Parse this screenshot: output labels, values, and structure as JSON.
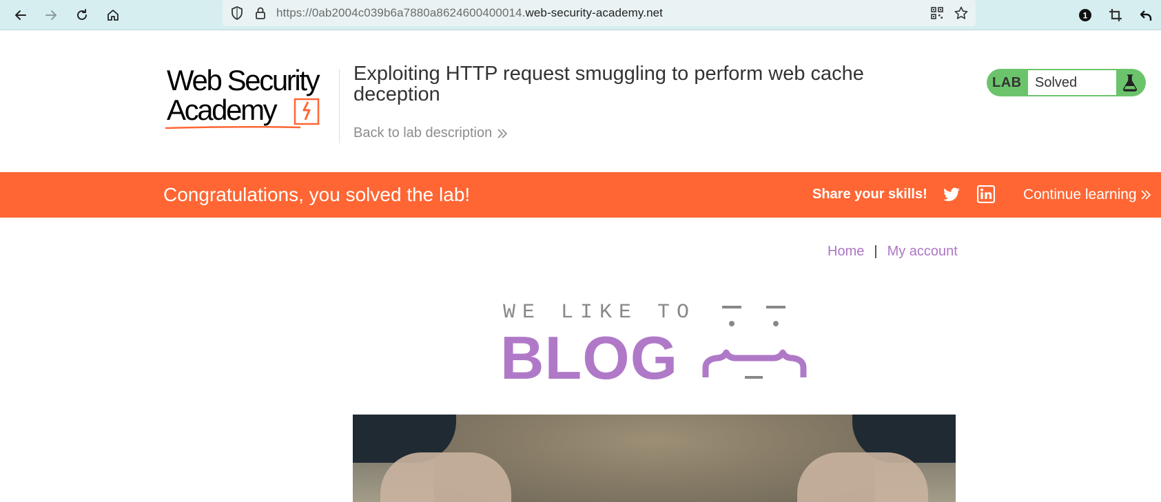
{
  "browser": {
    "url_prefix": "https://0ab2004c039b6a7880a8624600400014.",
    "url_domain": "web-security-academy.net",
    "notification_count": "1"
  },
  "lab": {
    "logo_line1": "Web Security",
    "logo_line2": "Academy",
    "title": "Exploiting HTTP request smuggling to perform web cache deception",
    "back_link": "Back to lab description",
    "badge_label": "LAB",
    "status": "Solved"
  },
  "banner": {
    "message": "Congratulations, you solved the lab!",
    "share": "Share your skills!",
    "continue": "Continue learning"
  },
  "blog_nav": {
    "home": "Home",
    "separator": "|",
    "account": "My account"
  },
  "blog_logo": {
    "tagline": "WE LIKE TO",
    "word": "BLOG"
  },
  "colors": {
    "toolbar_bg": "#d6eef0",
    "banner": "#ff6633",
    "accent_purple": "#ae75c5",
    "lab_green": "#6bc46b"
  },
  "icons": [
    "back-arrow-icon",
    "forward-arrow-icon",
    "reload-icon",
    "home-icon",
    "shield-icon",
    "lock-icon",
    "qr-code-icon",
    "star-icon",
    "notification-badge-icon",
    "crop-icon",
    "undo-icon",
    "flask-icon",
    "twitter-icon",
    "linkedin-icon",
    "double-chevron-icon"
  ]
}
